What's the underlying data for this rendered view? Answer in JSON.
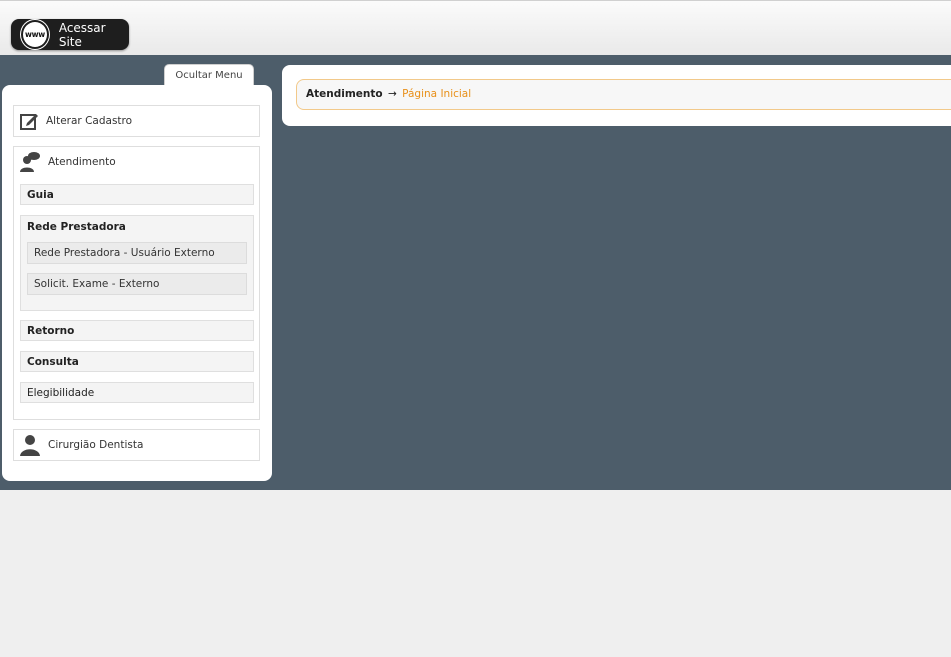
{
  "topbar": {
    "site_button_label": "Acessar Site",
    "www_badge": "www"
  },
  "sidebar": {
    "hide_menu_label": "Ocultar Menu",
    "sections": {
      "alterar": {
        "label": "Alterar Cadastro",
        "icon": "edit-icon"
      },
      "atendimento": {
        "label": "Atendimento",
        "icon": "chat-user-icon",
        "items": {
          "guia": "Guia",
          "rede": {
            "title": "Rede Prestadora",
            "sub": [
              "Rede Prestadora - Usuário Externo",
              "Solicit. Exame - Externo"
            ]
          },
          "retorno": "Retorno",
          "consulta": "Consulta",
          "elegibilidade": "Elegibilidade"
        }
      },
      "dentista": {
        "label": "Cirurgião Dentista",
        "icon": "user-icon"
      }
    }
  },
  "breadcrumb": {
    "root": "Atendimento",
    "arrow": "→",
    "current": "Página Inicial"
  },
  "colors": {
    "main_bg": "#4d5d6a",
    "accent": "#e8901a",
    "crumb_border": "#f2c98a"
  }
}
